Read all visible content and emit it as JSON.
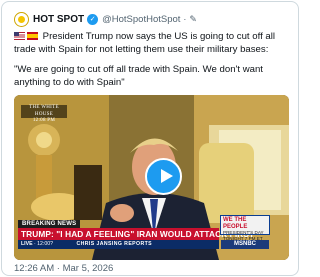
{
  "account": {
    "display_name": "HOT SPOT",
    "verified_icon": "verified-check-icon",
    "handle": "@HotSpotHotSpot",
    "separator": "·",
    "edit_icon": "pencil-icon"
  },
  "tweet": {
    "text_1": "President Trump now says the US is going to cut off all trade with Spain for not letting them use their military bases:",
    "text_2": "\"We are going to cut off all trade with Spain. We don't want anything to do with Spain\"",
    "flags": [
      "us-flag-icon",
      "spain-flag-icon"
    ]
  },
  "video": {
    "location_tag_line1": "THE WHITE HOUSE",
    "location_tag_line2": "12:08 PM",
    "breaking_label": "BREAKING NEWS",
    "headline": "TRUMP: \"I HAD A FEELING\" IRAN WOULD ATTACK FIRST",
    "live_label": "LIVE",
    "live_time": "· 12:00?",
    "reporter": "CHRIS JANSING REPORTS",
    "promo_title": "WE THE PEOPLE",
    "promo_sub": "PRESIDENT'S DAY",
    "promo_time": "TONIGHT 7 PM ET",
    "network": "MSNBC",
    "play_icon": "play-icon"
  },
  "meta": {
    "timestamp": "12:26 AM · Mar 5, 2026"
  },
  "colors": {
    "accent": "#1d9bf0",
    "breaking_red": "#c8102e",
    "text": "#0f1419",
    "secondary": "#536471"
  }
}
